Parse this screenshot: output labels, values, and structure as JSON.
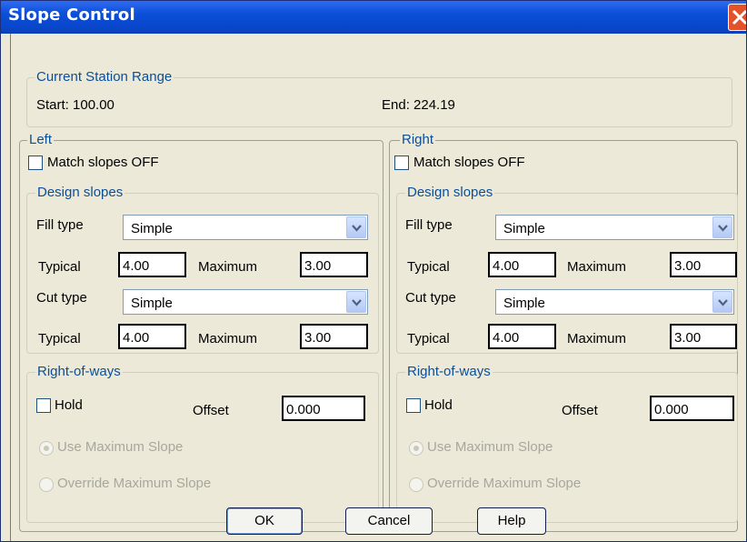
{
  "window": {
    "title": "Slope Control"
  },
  "station_range": {
    "legend": "Current Station Range",
    "start": "Start: 100.00",
    "end": "End: 224.19"
  },
  "left": {
    "legend": "Left",
    "match_slopes": "Match slopes OFF",
    "design_slopes": {
      "legend": "Design slopes",
      "fill_type_label": "Fill type",
      "fill_type_value": "Simple",
      "fill_typical_label": "Typical",
      "fill_typical_value": "4.00",
      "fill_maximum_label": "Maximum",
      "fill_maximum_value": "3.00",
      "cut_type_label": "Cut type",
      "cut_type_value": "Simple",
      "cut_typical_label": "Typical",
      "cut_typical_value": "4.00",
      "cut_maximum_label": "Maximum",
      "cut_maximum_value": "3.00"
    },
    "right_of_ways": {
      "legend": "Right-of-ways",
      "hold_label": "Hold",
      "offset_label": "Offset",
      "offset_value": "0.000",
      "use_max_slope": "Use Maximum Slope",
      "override_max_slope": "Override Maximum Slope"
    }
  },
  "right": {
    "legend": "Right",
    "match_slopes": "Match slopes OFF",
    "design_slopes": {
      "legend": "Design slopes",
      "fill_type_label": "Fill type",
      "fill_type_value": "Simple",
      "fill_typical_label": "Typical",
      "fill_typical_value": "4.00",
      "fill_maximum_label": "Maximum",
      "fill_maximum_value": "3.00",
      "cut_type_label": "Cut type",
      "cut_type_value": "Simple",
      "cut_typical_label": "Typical",
      "cut_typical_value": "4.00",
      "cut_maximum_label": "Maximum",
      "cut_maximum_value": "3.00"
    },
    "right_of_ways": {
      "legend": "Right-of-ways",
      "hold_label": "Hold",
      "offset_label": "Offset",
      "offset_value": "0.000",
      "use_max_slope": "Use Maximum Slope",
      "override_max_slope": "Override Maximum Slope"
    }
  },
  "buttons": {
    "ok": "OK",
    "cancel": "Cancel",
    "help": "Help"
  },
  "colors": {
    "titlebar": "#0b4fd8",
    "legend_text": "#0b4f98",
    "close_button": "#e2532c",
    "dialog_bg": "#ece9d8"
  },
  "icons": {
    "close": "close-icon",
    "dropdown": "chevron-down-icon"
  }
}
